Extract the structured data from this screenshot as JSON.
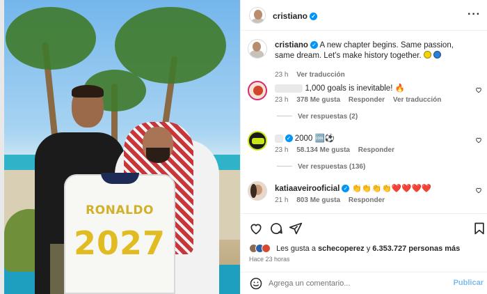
{
  "post": {
    "username": "cristiano",
    "caption": "A new chapter begins. Same passion, same dream. Let's make history together.",
    "caption_emojis": [
      "yellow-circle",
      "blue-circle"
    ],
    "caption_time": "23 h",
    "translate_label": "Ver traducción"
  },
  "photo": {
    "jersey_name": "RONALDO",
    "jersey_number": "2027"
  },
  "comments": [
    {
      "username": "",
      "text": "1,000 goals is inevitable! 🔥",
      "time": "23 h",
      "likes": "378 Me gusta",
      "reply_label": "Responder",
      "translate_label": "Ver traducción",
      "replies_label": "Ver respuestas (2)"
    },
    {
      "username": "",
      "text": "2000 🆒⚽",
      "time": "23 h",
      "likes": "58.134 Me gusta",
      "reply_label": "Responder",
      "replies_label": "Ver respuestas (136)"
    },
    {
      "username": "katiaaveirooficial",
      "text": "👏👏👏👏❤️❤️❤️❤️",
      "time": "21 h",
      "likes": "803 Me gusta",
      "reply_label": "Responder"
    }
  ],
  "engagement": {
    "liked_by_prefix": "Les gusta a",
    "liked_by_user": "schecoperez",
    "liked_by_joiner": "y",
    "liked_by_count": "6.353.727 personas más",
    "time_ago": "Hace 23 horas"
  },
  "composer": {
    "placeholder": "Agrega un comentario...",
    "publish_label": "Publicar"
  },
  "colors": {
    "verified": "#0095f6",
    "publish": "#7bbcf0",
    "heart": "#ed4956"
  },
  "icons": [
    "more-icon",
    "heart-icon",
    "comment-icon",
    "share-icon",
    "bookmark-icon",
    "emoji-icon",
    "verified-icon"
  ]
}
